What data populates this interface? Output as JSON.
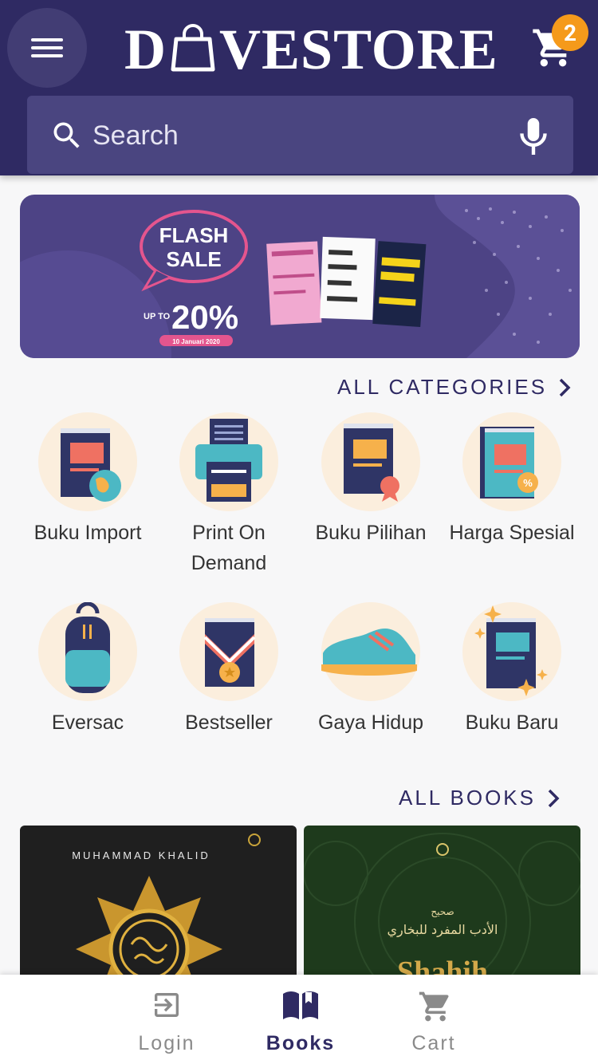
{
  "header": {
    "logo_text_left": "D",
    "logo_text_right": "VESTORE",
    "cart_count": "2",
    "search_placeholder": "Search"
  },
  "banner": {
    "flash": "FLASH",
    "sale": "SALE",
    "upto": "UP TO",
    "percent": "20%",
    "date": "10 Januari 2020"
  },
  "categories_link": "ALL CATEGORIES",
  "categories": [
    {
      "label": "Buku Import",
      "icon": "book-globe-icon"
    },
    {
      "label": "Print On Demand",
      "icon": "printer-icon"
    },
    {
      "label": "Buku Pilihan",
      "icon": "book-ribbon-icon"
    },
    {
      "label": "Harga Spesial",
      "icon": "book-discount-icon"
    },
    {
      "label": "Eversac",
      "icon": "backpack-icon"
    },
    {
      "label": "Bestseller",
      "icon": "book-medal-icon"
    },
    {
      "label": "Gaya Hidup",
      "icon": "sneaker-icon"
    },
    {
      "label": "Buku Baru",
      "icon": "book-sparkle-icon"
    }
  ],
  "books_link": "ALL BOOKS",
  "books": [
    {
      "author": "MUHAMMAD KHALID",
      "title": ""
    },
    {
      "author": "",
      "title": "Shahih"
    }
  ],
  "nav": {
    "login": "Login",
    "books": "Books",
    "cart": "Cart"
  },
  "colors": {
    "header_bg": "#2f2a63",
    "accent": "#f59a1b",
    "active_nav": "#2f2a63",
    "inactive_nav": "#8a8a8a"
  }
}
